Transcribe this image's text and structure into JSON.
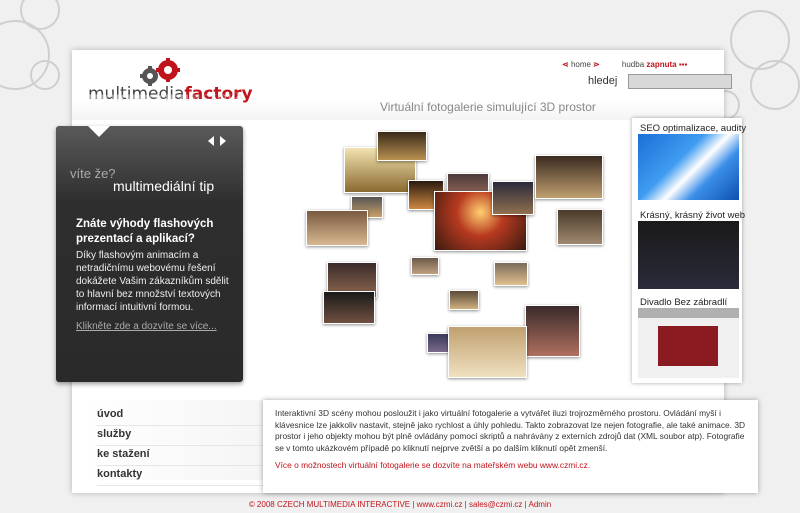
{
  "logo": {
    "part1": "multimedia",
    "part2": "factory"
  },
  "topnav": {
    "home": "home",
    "music_label": "hudba",
    "music_state": "zapnuta"
  },
  "search": {
    "label": "hledej",
    "value": ""
  },
  "headline": "Virtuální fotogalerie simulující 3D prostor",
  "tip": {
    "small": "víte že?",
    "big": "multimediální tip",
    "heading": "Znáte výhody flashových prezentací a aplikací?",
    "body": "Díky flashovým animacím a netradičnímu webovému řešení dokážete Vašim zákazníkům sdělit to hlavní bez množství textových informací intuitivní formou.",
    "link": "Klikněte zde a dozvíte se více..."
  },
  "sidebar": [
    {
      "title": "SEO optimalizace, audity"
    },
    {
      "title": "Krásný, krásný život web"
    },
    {
      "title": "Divadlo Bez zábradlí"
    }
  ],
  "menu": [
    "úvod",
    "služby",
    "ke stažení",
    "kontakty"
  ],
  "info": {
    "text": "Interaktivní 3D scény mohou posloužit i jako virtuální fotogalerie a vytvářet iluzi trojrozměrného prostoru. Ovládání myší i klávesnice lze jakkoliv nastavit, stejně jako rychlost a úhly pohledu. Takto zobrazovat lze nejen fotografie, ale také animace. 3D prostor i jeho objekty mohou být plně ovládány pomocí skriptů a nahrávány z externích zdrojů dat (XML soubor atp). Fotografie se v tomto ukázkovém případě po kliknutí nejprve zvětší a po dalším kliknutí opět zmenší.",
    "link": "Více o možnostech virtuální fotogalerie se dozvíte na mateřském webu www.czmi.cz."
  },
  "footer": "© 2008 CZECH MULTIMEDIA INTERACTIVE | www.czmi.cz | sales@czmi.cz | Admin",
  "colors": {
    "accent": "#c0141c",
    "panel": "#2e2e2e"
  }
}
